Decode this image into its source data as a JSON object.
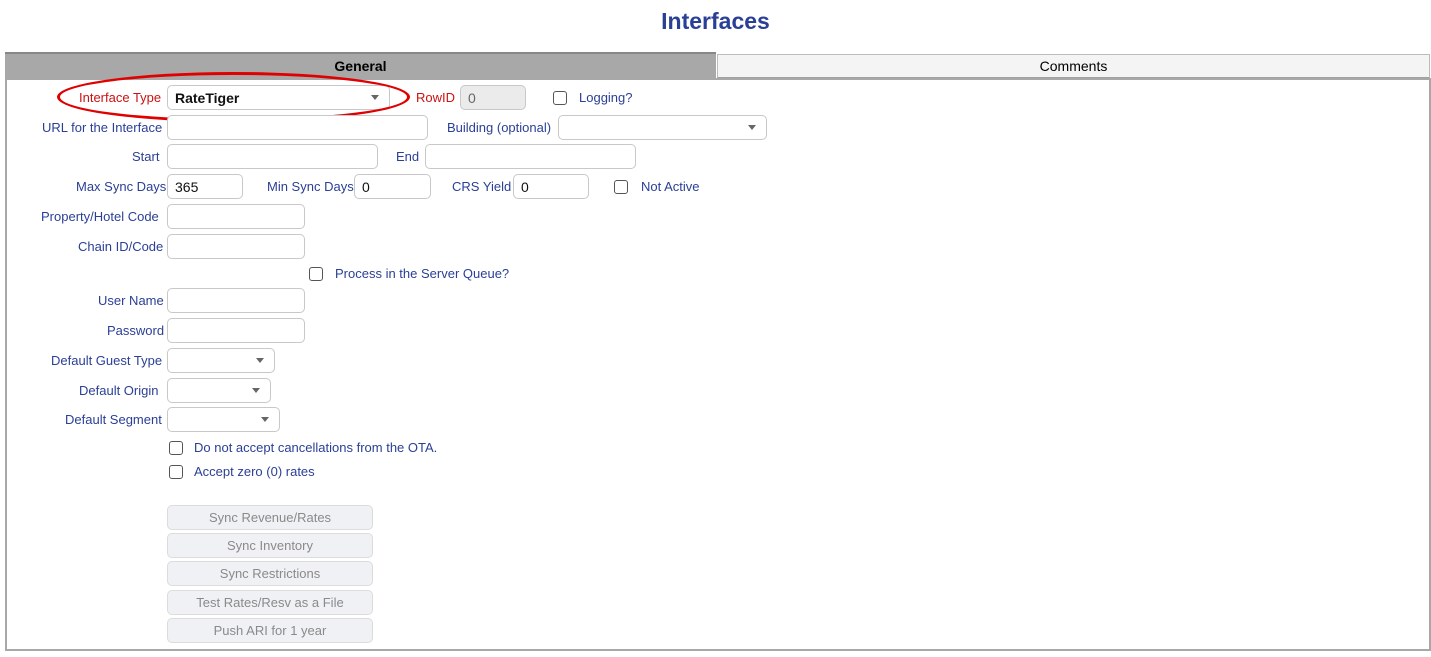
{
  "page": {
    "title": "Interfaces"
  },
  "tabs": [
    {
      "label": "General"
    },
    {
      "label": "Comments"
    }
  ],
  "form": {
    "interface_type": {
      "label": "Interface Type",
      "value": "RateTiger"
    },
    "rowid": {
      "label": "RowID",
      "value": "0"
    },
    "logging": {
      "label": "Logging?",
      "checked": false
    },
    "url": {
      "label": "URL for the Interface",
      "value": ""
    },
    "building": {
      "label": "Building (optional)",
      "value": ""
    },
    "start": {
      "label": "Start",
      "value": ""
    },
    "end": {
      "label": "End",
      "value": ""
    },
    "max_sync_days": {
      "label": "Max Sync Days",
      "value": "365"
    },
    "min_sync_days": {
      "label": "Min Sync Days",
      "value": "0"
    },
    "crs_yield": {
      "label": "CRS Yield",
      "value": "0"
    },
    "not_active": {
      "label": "Not Active",
      "checked": false
    },
    "property_code": {
      "label": "Property/Hotel Code",
      "value": ""
    },
    "chain_id": {
      "label": "Chain ID/Code",
      "value": ""
    },
    "server_queue": {
      "label": "Process in the Server Queue?",
      "checked": false
    },
    "user_name": {
      "label": "User Name",
      "value": ""
    },
    "password": {
      "label": "Password",
      "value": ""
    },
    "default_guest_type": {
      "label": "Default Guest Type",
      "value": ""
    },
    "default_origin": {
      "label": "Default Origin",
      "value": ""
    },
    "default_segment": {
      "label": "Default Segment",
      "value": ""
    },
    "no_cancellations": {
      "label": "Do not accept cancellations from the OTA.",
      "checked": false
    },
    "zero_rates": {
      "label": "Accept zero (0) rates",
      "checked": false
    }
  },
  "buttons": {
    "sync_revenue": "Sync Revenue/Rates",
    "sync_inventory": "Sync Inventory",
    "sync_restrictions": "Sync Restrictions",
    "test_rates": "Test Rates/Resv as a File",
    "push_ari": "Push ARI for 1 year"
  },
  "colors": {
    "label": "#2a3f96",
    "required_label": "#cc1111",
    "highlight_ellipse": "#e00000",
    "active_tab": "#a8a8a8"
  }
}
